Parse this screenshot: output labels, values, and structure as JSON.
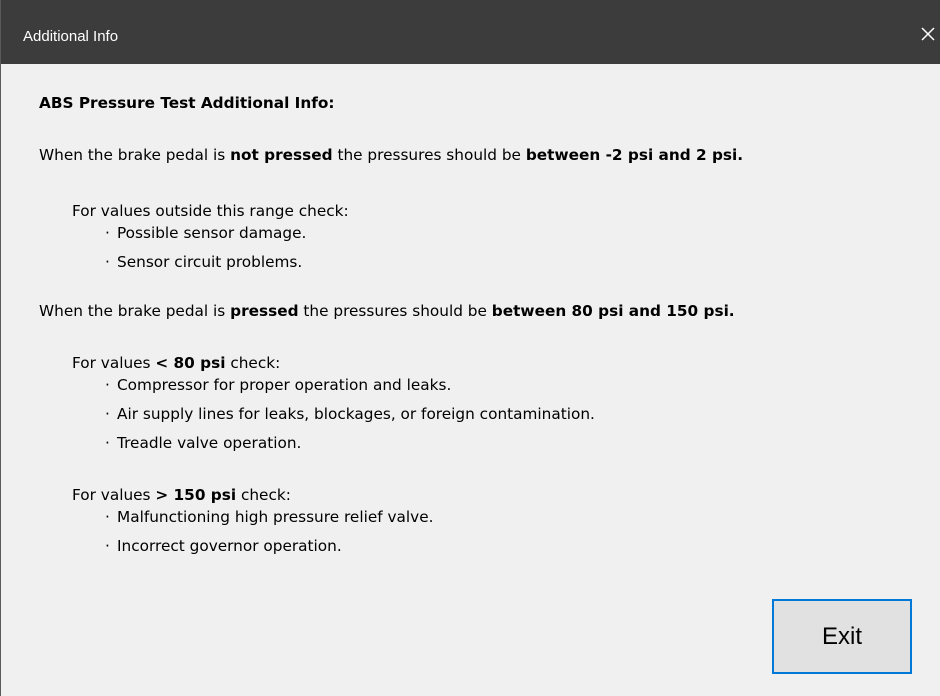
{
  "window": {
    "title": "Additional Info"
  },
  "content": {
    "heading": "ABS Pressure Test Additional Info:",
    "not_pressed": {
      "pre": "When the brake pedal is ",
      "bold1": "not pressed",
      "mid": " the pressures should be ",
      "bold2": "between -2 psi and 2 psi."
    },
    "not_pressed_check": "For values outside this range check:",
    "not_pressed_items": [
      "Possible sensor damage.",
      "Sensor circuit problems."
    ],
    "pressed": {
      "pre": "When the brake pedal is ",
      "bold1": "pressed",
      "mid": " the pressures should be ",
      "bold2": "between 80 psi and 150 psi."
    },
    "low_check": {
      "pre": "For values ",
      "bold": "< 80 psi",
      "post": " check:"
    },
    "low_items": [
      "Compressor for proper operation and leaks.",
      "Air supply lines for leaks, blockages, or foreign contamination.",
      "Treadle valve operation."
    ],
    "high_check": {
      "pre": "For values ",
      "bold": "> 150 psi",
      "post": " check:"
    },
    "high_items": [
      "Malfunctioning high pressure relief valve.",
      "Incorrect governor operation."
    ],
    "bullet_char": "·"
  },
  "buttons": {
    "exit_label": "Exit"
  },
  "colors": {
    "titlebar": "#3c3c3c",
    "background": "#f0f0f0",
    "button_border": "#0078d7"
  }
}
